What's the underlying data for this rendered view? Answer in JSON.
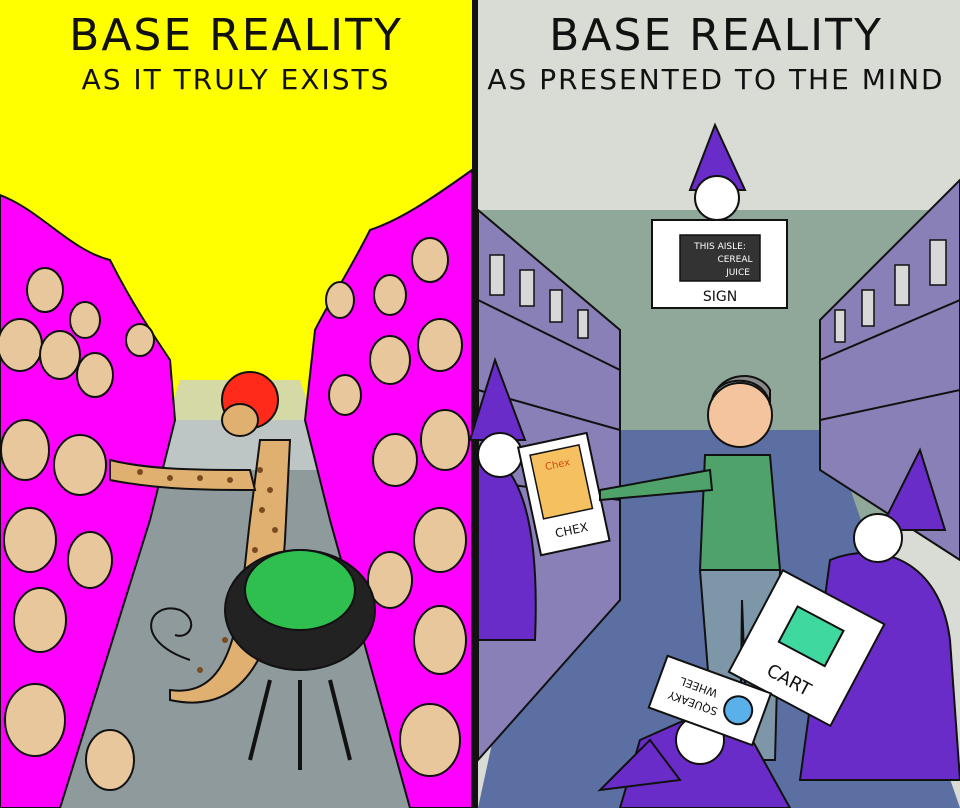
{
  "left_panel": {
    "title": "BASE REALITY",
    "subtitle": "AS IT TRULY EXISTS"
  },
  "right_panel": {
    "title": "BASE REALITY",
    "subtitle": "AS PRESENTED TO THE MIND",
    "sign": {
      "screen_line1": "THIS AISLE:",
      "screen_line2": "CEREAL",
      "screen_line3": "JUICE",
      "label": "SIGN"
    },
    "cereal_box": {
      "brand": "Chex",
      "label": "CHEX"
    },
    "cart_card": {
      "label": "CART"
    },
    "wheel_card": {
      "line1": "SQUEAKY",
      "line2": "WHEEL"
    }
  },
  "colors": {
    "left_sky": "#ffff00",
    "left_walls": "#ff00ff",
    "right_wall": "#d9dcd5",
    "right_back_wall": "#8fa89a",
    "shelf": "#8a80b8",
    "floor": "#5b6fa3",
    "wizard": "#6a2cc9",
    "shopper_shirt": "#4fa36a",
    "cart_icon": "#3fd9a0"
  }
}
